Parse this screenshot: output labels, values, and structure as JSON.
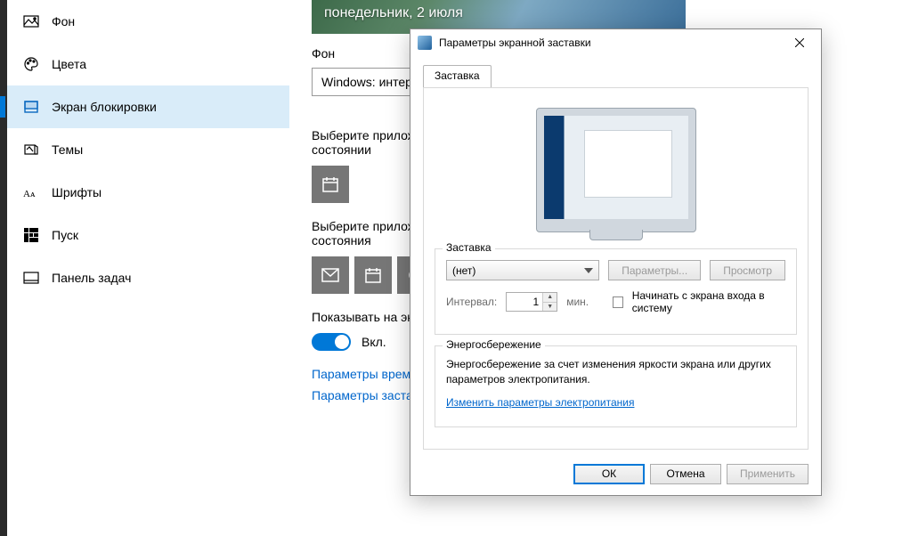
{
  "sidebar": {
    "items": [
      {
        "label": "Фон"
      },
      {
        "label": "Цвета"
      },
      {
        "label": "Экран блокировки"
      },
      {
        "label": "Темы"
      },
      {
        "label": "Шрифты"
      },
      {
        "label": "Пуск"
      },
      {
        "label": "Панель задач"
      }
    ],
    "active_index": 2
  },
  "main": {
    "preview_date": "понедельник, 2 июля",
    "bg_label": "Фон",
    "bg_combo": "Windows: интересное",
    "chooseapp_text": "Выберите приложение для показа подробные сведения о состоянии",
    "chooseapp2_text": "Выберите приложения, для которых будут отображаться состояния",
    "fun_facts_text": "Показывать на экране входа забавные факты, блокировки",
    "toggle_on": "Вкл.",
    "link_timeout": "Параметры времени ожидания экрана",
    "link_saver": "Параметры заставки"
  },
  "dialog": {
    "title": "Параметры экранной заставки",
    "tab_label": "Заставка",
    "saver": {
      "legend": "Заставка",
      "dropdown_value": "(нет)",
      "btn_params": "Параметры...",
      "btn_preview": "Просмотр",
      "interval_label": "Интервал:",
      "interval_value": "1",
      "interval_unit": "мин.",
      "checkbox_label": "Начинать с экрана входа в систему"
    },
    "power": {
      "legend": "Энергосбережение",
      "text": "Энергосбережение за счет изменения яркости экрана или других параметров электропитания.",
      "link": "Изменить параметры электропитания"
    },
    "footer": {
      "ok": "ОК",
      "cancel": "Отмена",
      "apply": "Применить"
    }
  }
}
